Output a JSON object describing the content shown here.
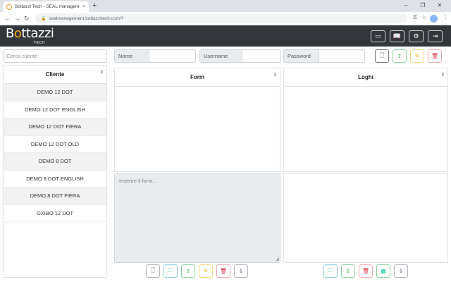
{
  "browser": {
    "tab_title": "Bottazzi Tech - SEAL manageme",
    "tab_close": "×",
    "new_tab": "+",
    "url": "sealmanagement.bottazzitech.com/?",
    "win_min": "–",
    "win_max": "❐",
    "win_close": "✕"
  },
  "header": {
    "logo_pre": "B",
    "logo_o": "o",
    "logo_post": "ttazzi",
    "logo_sub": "TECH"
  },
  "sidebar": {
    "search_placeholder": "Cerca cliente",
    "column_header": "Cliente",
    "clients": [
      "DEMO 12 DOT",
      "DEMO 12 DOT ENGLISH",
      "DEMO 12 DOT FIERA",
      "DEMO 12 DOT OLD",
      "DEMO 8 DOT",
      "DEMO 8 DOT ENGLISH",
      "DEMO 8 DOT FIERA",
      "OXIBO 12 DOT"
    ]
  },
  "credentials": {
    "nome_label": "Nome",
    "username_label": "Username",
    "password_label": "Password"
  },
  "panels": {
    "form_header": "Form",
    "loghi_header": "Loghi",
    "form_textarea_placeholder": "Inserire il form..."
  },
  "icons": {
    "new_file": "🗋",
    "folder": "🗀",
    "upload": "⇪",
    "edit": "✎",
    "delete": "🗑",
    "download": "⇩",
    "grid": "▦",
    "sort": "⇕",
    "presentation": "▭",
    "book": "📖",
    "gear": "⚙",
    "logout": "⇥",
    "back": "←",
    "forward": "→",
    "reload": "↻",
    "lock": "🔒",
    "key": "⚿",
    "star": "☆",
    "menu": "⋮"
  },
  "colors": {
    "header_bg": "#33363b",
    "logo_accent": "#f4a21d",
    "stripe": "#f2f2f2"
  }
}
